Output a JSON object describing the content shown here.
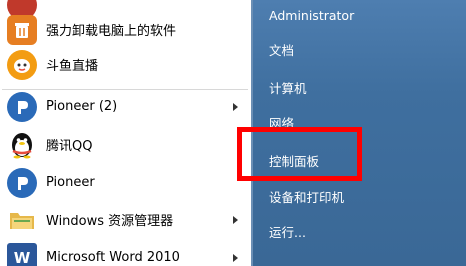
{
  "left_panel": {
    "items": [
      {
        "label": "",
        "icon": "app-icon-partial",
        "color": "#c0392b"
      },
      {
        "label": "强力卸载电脑上的软件",
        "icon": "uninstaller-icon",
        "color": "#e67e22"
      },
      {
        "label": "斗鱼直播",
        "icon": "douyu-icon",
        "color": "#f39c12"
      },
      {
        "label": "Pioneer (2)",
        "icon": "pioneer-icon",
        "color": "#2a6ab8"
      },
      {
        "label": "腾讯QQ",
        "icon": "qq-penguin-icon",
        "color": "#111111"
      },
      {
        "label": "Pioneer",
        "icon": "pioneer-icon",
        "color": "#2a6ab8"
      },
      {
        "label": "Windows 资源管理器",
        "icon": "folder-icon",
        "color": "#e6b84a"
      },
      {
        "label": "Microsoft Word 2010",
        "icon": "word-icon",
        "color": "#2b579a"
      }
    ]
  },
  "right_panel": {
    "items": [
      {
        "label": "Administrator"
      },
      {
        "label": "文档"
      },
      {
        "label": "计算机"
      },
      {
        "label": "网络"
      },
      {
        "label": "控制面板"
      },
      {
        "label": "设备和打印机"
      },
      {
        "label": "运行..."
      }
    ]
  },
  "colors": {
    "highlight_box": "#ff0000",
    "right_panel_bg": "#3f6f9f"
  }
}
